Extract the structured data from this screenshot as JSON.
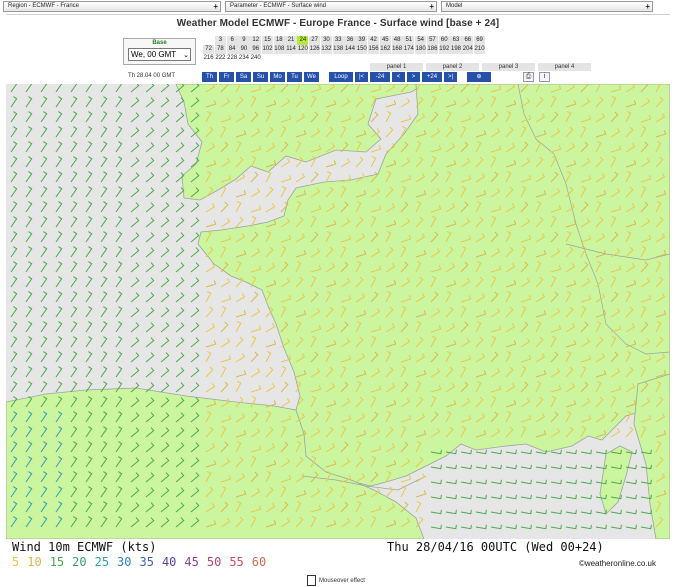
{
  "topbar": {
    "region": "Region - ECMWF - France",
    "parameter": "Parameter - ECMWF - Surface wind",
    "model": "Model",
    "plus": "+"
  },
  "header": {
    "title": "Weather Model ECMWF - Europe France - Surface wind [base + 24]",
    "base_label": "Base",
    "base_value": "We, 00 GMT",
    "current_time": "Th 28.04 00 GMT"
  },
  "hours": {
    "row1": [
      "",
      "3",
      "6",
      "9",
      "12",
      "15",
      "18",
      "21",
      "24",
      "27",
      "30",
      "33",
      "36",
      "39",
      "42",
      "45",
      "48",
      "51",
      "54",
      "57",
      "60",
      "63",
      "66",
      "69"
    ],
    "row2": [
      "72",
      "78",
      "84",
      "90",
      "96",
      "102",
      "108",
      "114",
      "120",
      "126",
      "132",
      "138",
      "144",
      "150",
      "156",
      "162",
      "168",
      "174",
      "180",
      "186",
      "192",
      "198",
      "204",
      "210"
    ],
    "row3": [
      "216",
      "222",
      "228",
      "234",
      "240"
    ],
    "selected": "24"
  },
  "panels": [
    "panel 1",
    "panel 2",
    "panel 3",
    "panel 4"
  ],
  "nav": {
    "days": [
      "Th",
      "Fr",
      "Sa",
      "Su",
      "Mo",
      "Tu",
      "We"
    ],
    "loop": "Loop",
    "first": "|<",
    "back24": "-24",
    "prev": "<",
    "next": ">",
    "fwd24": "+24",
    "last": ">|",
    "zoom": "⊕",
    "print": "⎙",
    "info": "i"
  },
  "legend": {
    "title": "Wind 10m ECMWF (kts)",
    "valid": "Thu 28/04/16 00UTC  (Wed 00+24)",
    "speeds": [
      {
        "value": "5",
        "color": "#e8c84a"
      },
      {
        "value": "10",
        "color": "#d9b94a"
      },
      {
        "value": "15",
        "color": "#4aa84a"
      },
      {
        "value": "20",
        "color": "#3a9a7a"
      },
      {
        "value": "25",
        "color": "#30a0a8"
      },
      {
        "value": "30",
        "color": "#3080b8"
      },
      {
        "value": "35",
        "color": "#4060b0"
      },
      {
        "value": "40",
        "color": "#6040a0"
      },
      {
        "value": "45",
        "color": "#9040a0"
      },
      {
        "value": "50",
        "color": "#b84080"
      },
      {
        "value": "55",
        "color": "#c85060"
      },
      {
        "value": "60",
        "color": "#c87050"
      }
    ],
    "credit": "©weatheronline.co.uk",
    "mouseover": "Mouseover effect"
  },
  "colors": {
    "land": "#ccf5a0",
    "sea": "#e6e6e6",
    "selected_hour": "#b6ea3d",
    "nav_button": "#2552a8"
  }
}
